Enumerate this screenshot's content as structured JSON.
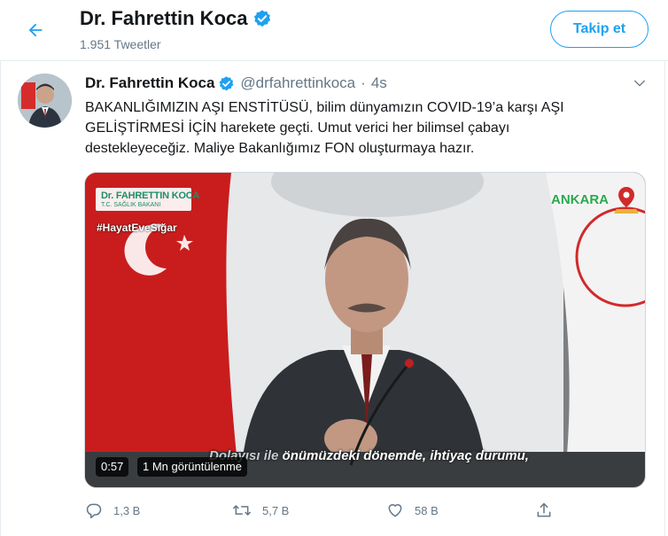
{
  "header": {
    "back_icon": "arrow-left-icon",
    "title": "Dr. Fahrettin Koca",
    "subtitle": "1.951 Tweetler",
    "verified_icon": "verified-badge-icon",
    "follow_label": "Takip et",
    "accent_color": "#1da1f2"
  },
  "tweet": {
    "name": "Dr. Fahrettin Koca",
    "handle": "@drfahrettinkoca",
    "separator": "·",
    "time": "4s",
    "caret_icon": "chevron-down-icon",
    "lines": [
      "BAKANLIĞIMIZIN AŞI ENSTİTÜSÜ, bilim dünyamızın COVID-19’a karşı AŞI",
      "GELİŞTİRMESİ İÇİN harekete geçti. Umut verici her bilimsel çabayı",
      "destekleyeceğiz. Maliye Bakanlığımız FON oluşturmaya hazır."
    ]
  },
  "media": {
    "overlay_name": "Dr. FAHRETTIN KOCA",
    "overlay_title": "T.C. SAĞLIK BAKANI",
    "hashtag": "#HayatEveSığar",
    "location": "ANKARA",
    "subtitle_pre": "Dolayısı ile",
    "subtitle": "önümüzdeki dönemde, ihtiyaç durumu,",
    "duration": "0:57",
    "views": "1 Mn görüntülenme"
  },
  "actions": {
    "reply_icon": "reply-icon",
    "reply_count": "1,3 B",
    "retweet_icon": "retweet-icon",
    "retweet_count": "5,7 B",
    "like_icon": "heart-icon",
    "like_count": "58 B",
    "share_icon": "share-icon"
  }
}
